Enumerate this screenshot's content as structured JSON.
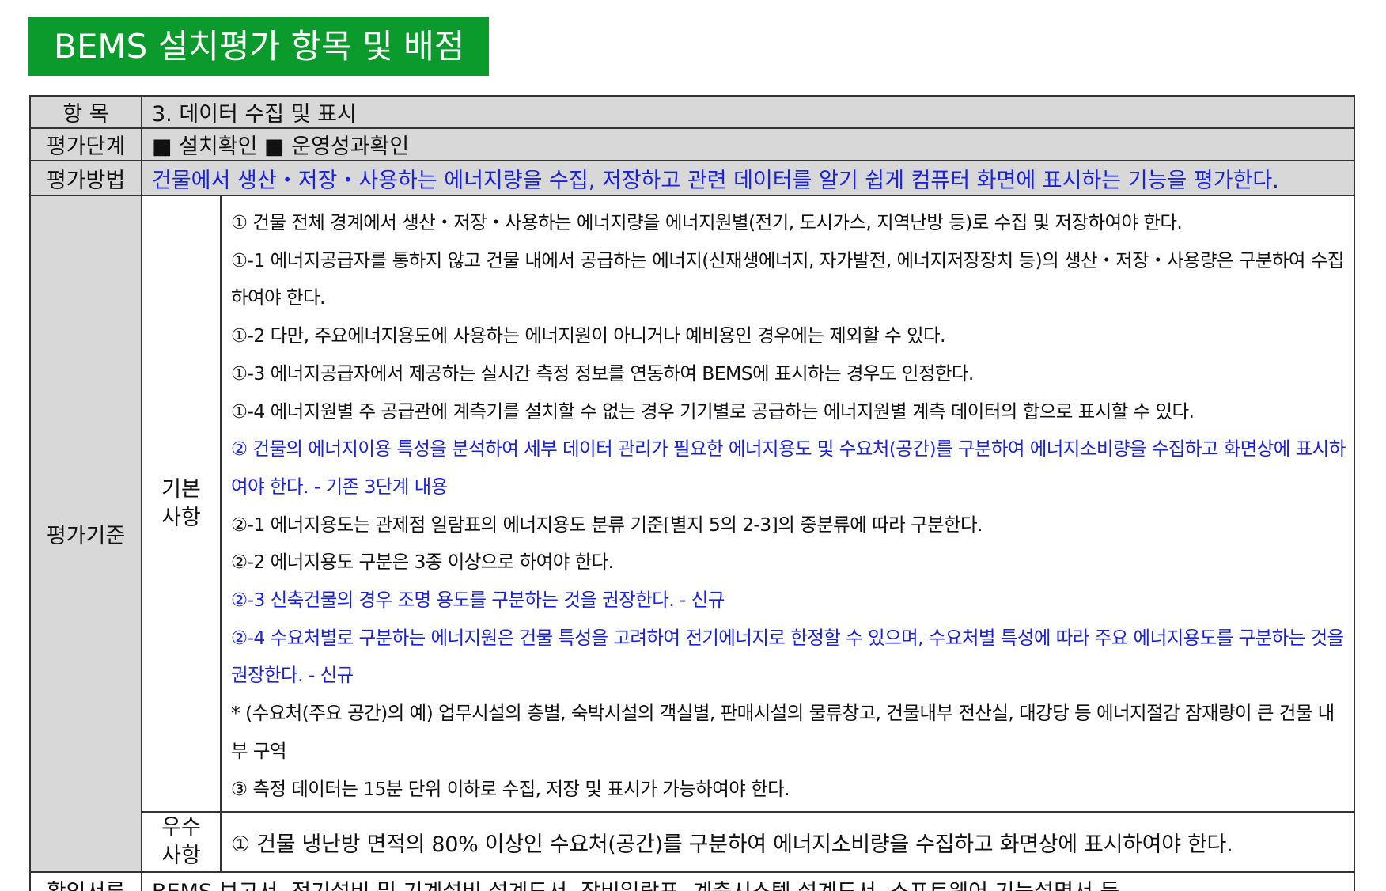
{
  "title": "BEMS 설치평가 항목 및 배점",
  "rows": {
    "item": {
      "label": "항 목",
      "value": "3. 데이터 수집 및 표시"
    },
    "stage": {
      "label": "평가단계",
      "value": "■ 설치확인 ■ 운영성과확인"
    },
    "method": {
      "label": "평가방법",
      "value": "건물에서 생산・저장・사용하는 에너지량을 수집, 저장하고 관련 데이터를 알기 쉽게 컴퓨터 화면에 표시하는 기능을 평가한다."
    },
    "criteria": {
      "label": "평가기준",
      "basic": {
        "label": "기본\n사항",
        "lines": [
          {
            "text": "① 건물 전체 경계에서 생산・저장・사용하는 에너지량을 에너지원별(전기, 도시가스, 지역난방 등)로 수집 및 저장하여야 한다.",
            "color": "black"
          },
          {
            "text": "①-1 에너지공급자를 통하지 않고 건물 내에서 공급하는 에너지(신재생에너지, 자가발전, 에너지저장장치 등)의 생산・저장・사용량은 구분하여 수집하여야 한다.",
            "color": "black"
          },
          {
            "text": "①-2 다만, 주요에너지용도에 사용하는 에너지원이 아니거나 예비용인 경우에는 제외할 수 있다.",
            "color": "black"
          },
          {
            "text": "①-3 에너지공급자에서 제공하는 실시간 측정 정보를 연동하여 BEMS에 표시하는 경우도 인정한다.",
            "color": "black"
          },
          {
            "text": "①-4 에너지원별 주 공급관에 계측기를 설치할 수 없는 경우 기기별로 공급하는 에너지원별 계측 데이터의 합으로 표시할 수 있다.",
            "color": "black"
          },
          {
            "text": "② 건물의 에너지이용 특성을 분석하여 세부 데이터 관리가 필요한 에너지용도 및 수요처(공간)를 구분하여 에너지소비량을 수집하고 화면상에 표시하여야 한다. - 기존 3단계 내용",
            "color": "blue"
          },
          {
            "text": "②-1 에너지용도는 관제점 일람표의 에너지용도 분류 기준[별지 5의 2-3]의 중분류에 따라 구분한다.",
            "color": "black"
          },
          {
            "text": "②-2 에너지용도 구분은 3종 이상으로 하여야 한다.",
            "color": "black"
          },
          {
            "text": "②-3 신축건물의 경우 조명 용도를 구분하는 것을 권장한다. - 신규",
            "color": "blue"
          },
          {
            "text": "②-4 수요처별로 구분하는 에너지원은 건물 특성을 고려하여 전기에너지로 한정할 수 있으며, 수요처별 특성에 따라 주요 에너지용도를 구분하는 것을 권장한다. - 신규",
            "color": "blue"
          },
          {
            "text": "* (수요처(주요 공간)의 예) 업무시설의 층별, 숙박시설의 객실별, 판매시설의 물류창고, 건물내부 전산실, 대강당 등 에너지절감 잠재량이 큰 건물 내부 구역",
            "color": "black"
          },
          {
            "text": "③ 측정 데이터는 15분 단위 이하로 수집, 저장 및 표시가 가능하여야 한다.",
            "color": "black"
          }
        ]
      },
      "excellent": {
        "label": "우수\n사항",
        "text": "① 건물 냉난방 면적의 80% 이상인 수요처(공간)를 구분하여 에너지소비량을 수집하고 화면상에 표시하여야 한다."
      }
    },
    "docs": {
      "label": "확인서류",
      "value": "BEMS 보고서, 전기설비 및 기계설비 설계도서, 장비일람표, 계측시스템 설계도서, 소프트웨어 기능설명서 등"
    }
  },
  "colors": {
    "banner": "#0a9b2c",
    "header_bg": "#d8d8d8",
    "highlight_text": "#1a22e0"
  }
}
